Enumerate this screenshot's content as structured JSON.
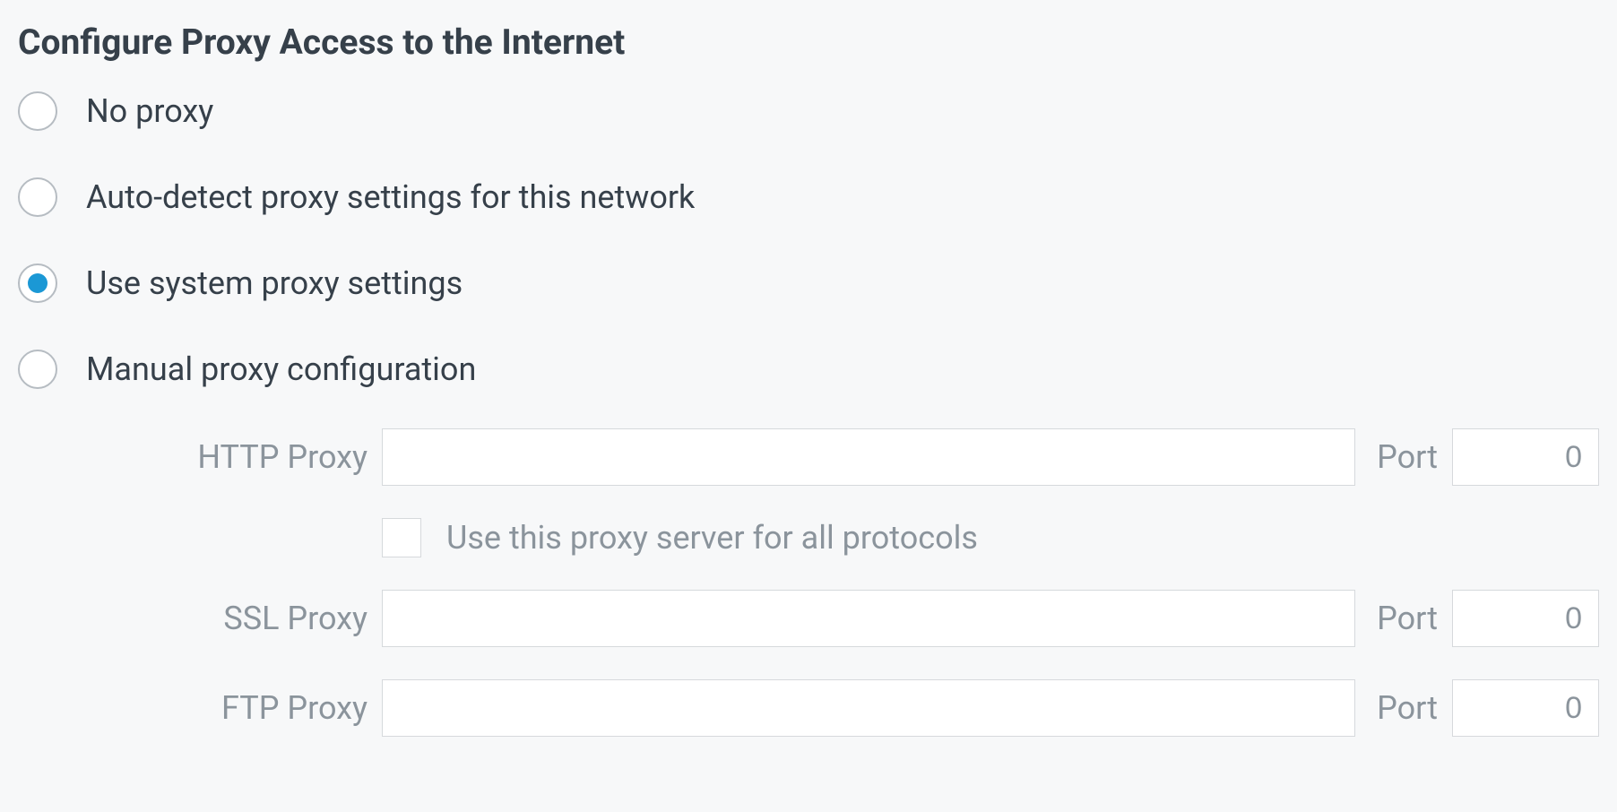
{
  "heading": "Configure Proxy Access to the Internet",
  "radios": {
    "no_proxy": "No proxy",
    "auto_detect": "Auto-detect proxy settings for this network",
    "system_proxy": "Use system proxy settings",
    "manual": "Manual proxy configuration",
    "selected": "system_proxy"
  },
  "fields": {
    "http_label": "HTTP Proxy",
    "http_value": "",
    "ssl_label": "SSL Proxy",
    "ssl_value": "",
    "ftp_label": "FTP Proxy",
    "ftp_value": "",
    "port_label": "Port",
    "http_port": "0",
    "ssl_port": "0",
    "ftp_port": "0"
  },
  "checkbox": {
    "use_all_protocols": "Use this proxy server for all protocols",
    "checked": false
  }
}
